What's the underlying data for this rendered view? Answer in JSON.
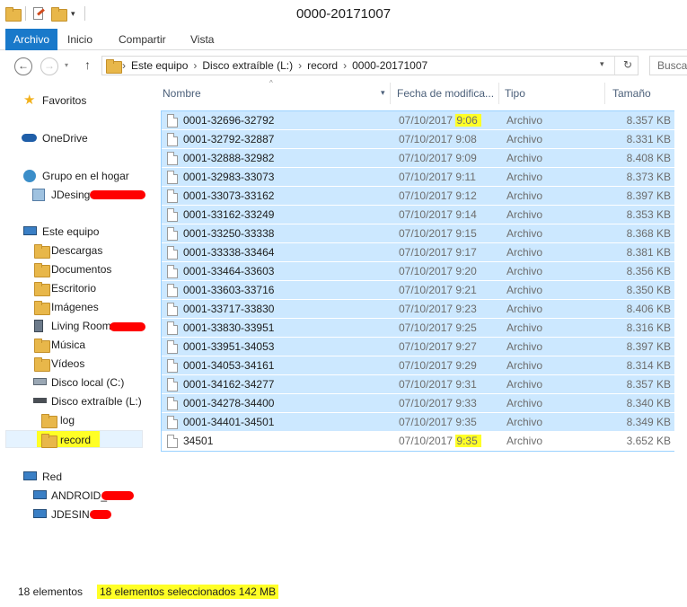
{
  "window": {
    "title": "0000-20171007",
    "quick_access": [
      "folder-icon",
      "properties-icon",
      "new-folder-icon",
      "customize-dropdown"
    ]
  },
  "ribbon": {
    "tabs": [
      "Archivo",
      "Inicio",
      "Compartir",
      "Vista"
    ]
  },
  "address": {
    "crumbs": [
      "Este equipo",
      "Disco extraíble (L:)",
      "record",
      "0000-20171007"
    ],
    "search_placeholder": "Busca"
  },
  "sidebar": {
    "favorites": "Favoritos",
    "onedrive": "OneDrive",
    "homegroup": "Grupo en el hogar",
    "homegroup_user": "JDesing",
    "this_pc": "Este equipo",
    "pc_items": [
      "Descargas",
      "Documentos",
      "Escritorio",
      "Imágenes",
      "Living Room",
      "Música",
      "Vídeos",
      "Disco local (C:)",
      "Disco extraíble (L:)"
    ],
    "drive_children": [
      "log",
      "record"
    ],
    "network": "Red",
    "network_items": [
      "ANDROID_",
      "JDESING"
    ]
  },
  "columns": {
    "name": "Nombre",
    "date": "Fecha de modifica...",
    "type": "Tipo",
    "size": "Tamaño"
  },
  "files": [
    {
      "name": "0001-32696-32792",
      "date": "07/10/2017",
      "time": "9:06",
      "type": "Archivo",
      "size": "8.357 KB"
    },
    {
      "name": "0001-32792-32887",
      "date": "07/10/2017",
      "time": "9:08",
      "type": "Archivo",
      "size": "8.331 KB"
    },
    {
      "name": "0001-32888-32982",
      "date": "07/10/2017",
      "time": "9:09",
      "type": "Archivo",
      "size": "8.408 KB"
    },
    {
      "name": "0001-32983-33073",
      "date": "07/10/2017",
      "time": "9:11",
      "type": "Archivo",
      "size": "8.373 KB"
    },
    {
      "name": "0001-33073-33162",
      "date": "07/10/2017",
      "time": "9:12",
      "type": "Archivo",
      "size": "8.397 KB"
    },
    {
      "name": "0001-33162-33249",
      "date": "07/10/2017",
      "time": "9:14",
      "type": "Archivo",
      "size": "8.353 KB"
    },
    {
      "name": "0001-33250-33338",
      "date": "07/10/2017",
      "time": "9:15",
      "type": "Archivo",
      "size": "8.368 KB"
    },
    {
      "name": "0001-33338-33464",
      "date": "07/10/2017",
      "time": "9:17",
      "type": "Archivo",
      "size": "8.381 KB"
    },
    {
      "name": "0001-33464-33603",
      "date": "07/10/2017",
      "time": "9:20",
      "type": "Archivo",
      "size": "8.356 KB"
    },
    {
      "name": "0001-33603-33716",
      "date": "07/10/2017",
      "time": "9:21",
      "type": "Archivo",
      "size": "8.350 KB"
    },
    {
      "name": "0001-33717-33830",
      "date": "07/10/2017",
      "time": "9:23",
      "type": "Archivo",
      "size": "8.406 KB"
    },
    {
      "name": "0001-33830-33951",
      "date": "07/10/2017",
      "time": "9:25",
      "type": "Archivo",
      "size": "8.316 KB"
    },
    {
      "name": "0001-33951-34053",
      "date": "07/10/2017",
      "time": "9:27",
      "type": "Archivo",
      "size": "8.397 KB"
    },
    {
      "name": "0001-34053-34161",
      "date": "07/10/2017",
      "time": "9:29",
      "type": "Archivo",
      "size": "8.314 KB"
    },
    {
      "name": "0001-34162-34277",
      "date": "07/10/2017",
      "time": "9:31",
      "type": "Archivo",
      "size": "8.357 KB"
    },
    {
      "name": "0001-34278-34400",
      "date": "07/10/2017",
      "time": "9:33",
      "type": "Archivo",
      "size": "8.340 KB"
    },
    {
      "name": "0001-34401-34501",
      "date": "07/10/2017",
      "time": "9:35",
      "type": "Archivo",
      "size": "8.349 KB"
    },
    {
      "name": "34501",
      "date": "07/10/2017",
      "time": "9:35",
      "type": "Archivo",
      "size": "3.652 KB"
    }
  ],
  "status": {
    "count": "18 elementos",
    "selection": "18 elementos seleccionados  142 MB"
  },
  "colors": {
    "accent": "#1979ca",
    "selection": "#cce8ff",
    "highlight": "#ffff26",
    "redaction": "#ff0000"
  }
}
